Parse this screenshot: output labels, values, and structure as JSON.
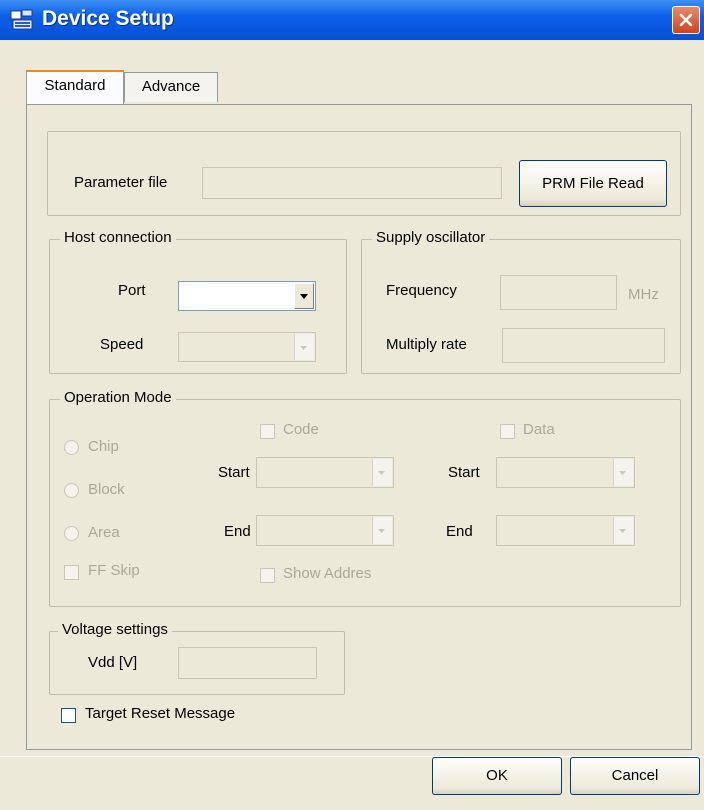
{
  "window": {
    "title": "Device Setup"
  },
  "tabs": [
    {
      "label": "Standard"
    },
    {
      "label": "Advance"
    }
  ],
  "parameter": {
    "label": "Parameter file",
    "value": "",
    "button": "PRM File Read"
  },
  "host": {
    "title": "Host connection",
    "port_label": "Port",
    "port_value": "",
    "speed_label": "Speed",
    "speed_value": ""
  },
  "supply": {
    "title": "Supply oscillator",
    "frequency_label": "Frequency",
    "frequency_value": "",
    "frequency_unit": "MHz",
    "multiply_label": "Multiply rate",
    "multiply_value": ""
  },
  "operation": {
    "title": "Operation Mode",
    "radios": [
      {
        "label": "Chip"
      },
      {
        "label": "Block"
      },
      {
        "label": "Area"
      }
    ],
    "ff_skip": "FF Skip",
    "code_label": "Code",
    "data_label": "Data",
    "start_label": "Start",
    "end_label": "End",
    "show_address": "Show Addres"
  },
  "voltage": {
    "title": "Voltage settings",
    "vdd_label": "Vdd [V]",
    "vdd_value": ""
  },
  "target_reset": "Target Reset Message",
  "buttons": {
    "ok": "OK",
    "cancel": "Cancel"
  }
}
